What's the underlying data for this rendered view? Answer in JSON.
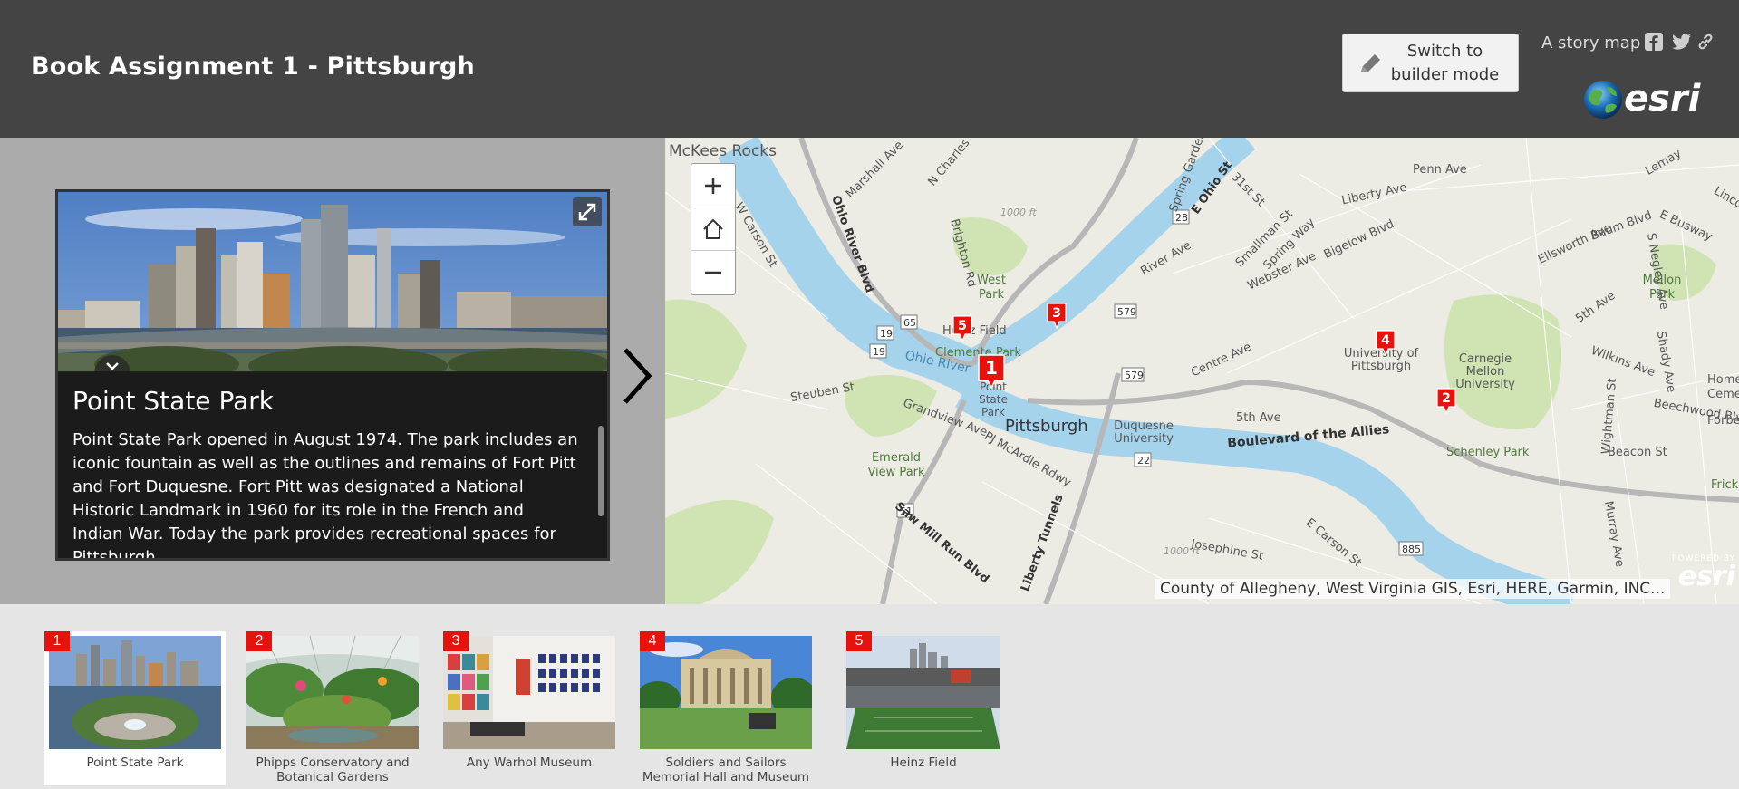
{
  "header": {
    "title": "Book Assignment 1 - Pittsburgh",
    "builder_button_label": "Switch to builder mode",
    "story_label": "A story map",
    "share_icons": [
      "facebook-icon",
      "twitter-icon",
      "link-icon"
    ],
    "logo_text": "esri"
  },
  "colors": {
    "header_bg": "#444444",
    "panel_bg": "#ababab",
    "strip_bg": "#e5e5e5",
    "marker_red": "#e8120c"
  },
  "active_entry": {
    "title": "Point State Park",
    "description": "Point State Park opened in August 1974. The park includes an iconic fountain as well as the outlines and remains of Fort Pitt and Fort Duquesne. Fort Pitt was designated a National Historic Landmark in 1960 for its role in the French and Indian War. Today the park provides recreational spaces for Pittsburgh"
  },
  "map": {
    "attribution": "County of Allegheny, West Virginia GIS, Esri, HERE, Garmin, INC...",
    "powered_by": "POWERED BY",
    "powered_logo": "esri",
    "labels": {
      "mckees": "McKees Rocks",
      "pittsburgh": "Pittsburgh",
      "boulevard": "Boulevard of the Allies",
      "ohio_river": "Ohio River",
      "univ_pitt": "University of Pittsburgh",
      "cmu": "Carnegie Mellon University",
      "schenley": "Schenley Park",
      "duquesne": "Duquesne University",
      "west_park": "West Park",
      "heinz": "Heinz Field",
      "clemente": "Clemente Park",
      "point_state": "Point State Park",
      "emerald": "Emerald View Park",
      "mellon": "Mellon Park",
      "penn_ave": "Penn Ave",
      "liberty_ave": "Liberty Ave",
      "centre_ave": "Centre Ave",
      "fifth_ave": "5th Ave",
      "baum": "Baum Blvd",
      "bigelow": "Bigelow Blvd",
      "webster": "Webster Ave",
      "river_ave": "River Ave",
      "grandview": "Grandview Ave",
      "mcardle": "PJ McArdle Rdwy",
      "saw_mill": "Saw Mill Run Blvd",
      "josephine": "Josephine St",
      "carson": "E Carson St",
      "ohio_blvd": "Ohio River Blvd",
      "wilkins": "Wilkins Ave",
      "beacon": "Beacon St",
      "forbes": "Forbes",
      "wightman": "Wightman St",
      "ellsworth": "Ellsworth Ave",
      "brighton": "Brighton Rd",
      "steuben": "Steuben St",
      "carson_w": "W Carson St",
      "smallman": "Smallman St",
      "spring_way": "Spring Way",
      "spring_garden": "Spring Garden",
      "marshall": "Marshall Ave",
      "charles": "N Charles",
      "ohio_st": "E Ohio St",
      "st31": "31st St",
      "negley": "S Negley Ave",
      "fifth_ave_2": "5th Ave",
      "busway": "E Busway",
      "lincoln": "Lincoln",
      "lemay": "Lemay",
      "tunnels": "Liberty Tunnels",
      "homewood": "Home Ceme",
      "frick": "Frick",
      "elev1": "1000 ft",
      "elev2": "1000 ft",
      "route19a": "19",
      "route19b": "19",
      "route65": "65",
      "route28": "28",
      "route579a": "579",
      "route579b": "579",
      "route22": "22",
      "route51": "51",
      "route885": "885",
      "beechwood": "Beechwood Blvd",
      "shady": "Shady Ave",
      "murray": "Murray Ave"
    },
    "markers": [
      {
        "num": "1",
        "name": "Point State Park"
      },
      {
        "num": "2",
        "name": "Phipps Conservatory and Botanical Gardens"
      },
      {
        "num": "3",
        "name": "Any Warhol Museum"
      },
      {
        "num": "4",
        "name": "Soldiers and Sailors Memorial Hall and Museum"
      },
      {
        "num": "5",
        "name": "Heinz Field"
      }
    ]
  },
  "thumbnails": [
    {
      "num": "1",
      "caption": "Point State Park",
      "active": true
    },
    {
      "num": "2",
      "caption": "Phipps Conservatory and Botanical Gardens",
      "active": false
    },
    {
      "num": "3",
      "caption": "Any Warhol Museum",
      "active": false
    },
    {
      "num": "4",
      "caption": "Soldiers and Sailors Memorial Hall and Museum",
      "active": false
    },
    {
      "num": "5",
      "caption": "Heinz Field",
      "active": false
    }
  ]
}
